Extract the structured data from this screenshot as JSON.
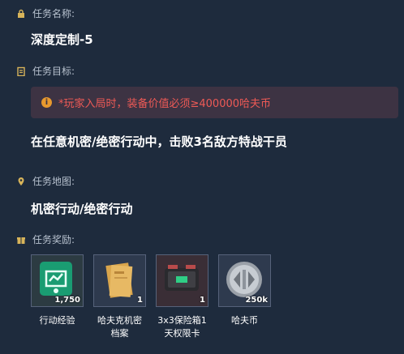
{
  "task_name": {
    "label": "任务名称:",
    "value": "深度定制-5"
  },
  "task_goal": {
    "label": "任务目标:",
    "warning": "*玩家入局时，装备价值必须≥400000哈夫币",
    "value": "在任意机密/绝密行动中，击败3名敌方特战干员"
  },
  "task_map": {
    "label": "任务地图:",
    "value": "机密行动/绝密行动"
  },
  "task_rewards": {
    "label": "任务奖励:",
    "items": [
      {
        "icon": "experience-icon",
        "count": "1,750",
        "name": "行动经验"
      },
      {
        "icon": "document-icon",
        "count": "1",
        "name": "哈夫克机密\n档案"
      },
      {
        "icon": "safe-box-icon",
        "count": "1",
        "name": "3x3保险箱1\n天权限卡"
      },
      {
        "icon": "coin-icon",
        "count": "250k",
        "name": "哈夫币"
      }
    ]
  },
  "colors": {
    "background": "#1e2b3d",
    "warning_text": "#ee5a56",
    "warning_bg": "#3d3343",
    "warning_icon": "#e8992e"
  }
}
